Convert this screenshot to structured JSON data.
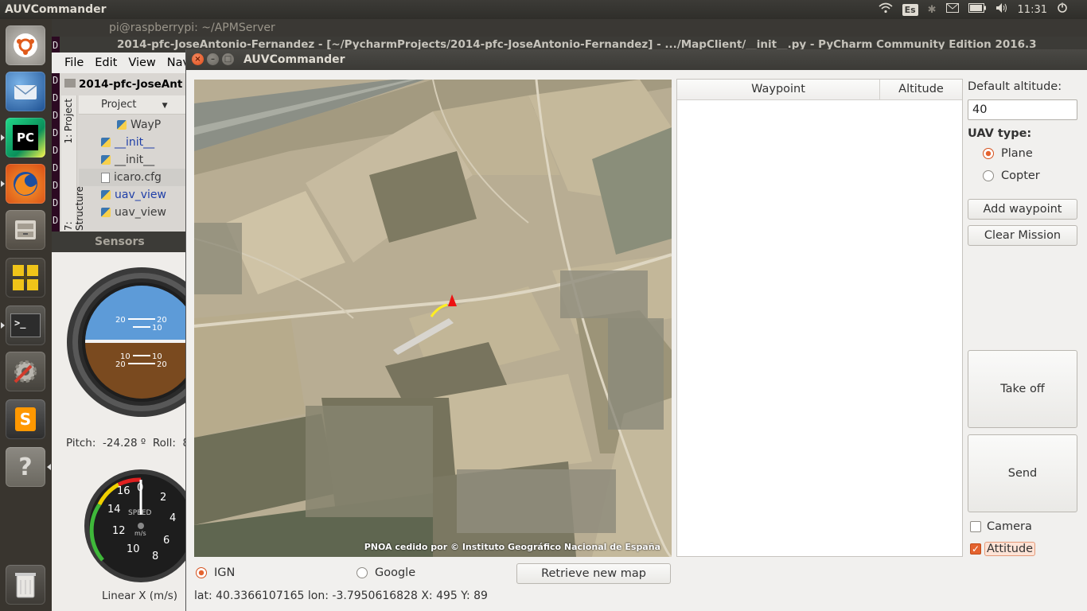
{
  "topbar": {
    "app_title": "AUVCommander",
    "keyboard_layout": "Es",
    "clock": "11:31"
  },
  "launcher": {
    "items": [
      "ubuntu-dash",
      "thunderbird",
      "pycharm",
      "firefox",
      "file-manager",
      "workspace-switcher",
      "terminal",
      "system-settings",
      "sublime-text",
      "help",
      "trash"
    ],
    "pycharm_label": "PC",
    "sublime_label": "S",
    "help_label": "?"
  },
  "terminal_window": {
    "title": "pi@raspberrypi: ~/APMServer"
  },
  "pycharm_window": {
    "title": "2014-pfc-JoseAntonio-Fernandez - [~/PycharmProjects/2014-pfc-JoseAntonio-Fernandez] - .../MapClient/__init__.py - PyCharm Community Edition 2016.3",
    "menu": [
      "File",
      "Edit",
      "View",
      "Navi"
    ],
    "breadcrumb": "2014-pfc-JoseAnt",
    "side_tabs": [
      "1: Project",
      "7: Structure"
    ],
    "project_header": "Project",
    "tree": [
      {
        "name": "WayP",
        "type": "py"
      },
      {
        "name": "__init__",
        "type": "py"
      },
      {
        "name": "__init__",
        "type": "py"
      },
      {
        "name": "icaro.cfg",
        "type": "cfg"
      },
      {
        "name": "uav_view",
        "type": "py"
      },
      {
        "name": "uav_view",
        "type": "py"
      }
    ],
    "terminal_strip": [
      "D",
      "D",
      "D",
      "D",
      "D",
      "D",
      "D",
      "D",
      "D",
      "D",
      "D",
      "D"
    ]
  },
  "sensors_window": {
    "title": "Sensors",
    "horizon_ticks": [
      "20",
      "10",
      "10",
      "20"
    ],
    "pitch_label": "Pitch:",
    "pitch_value": "-24.28",
    "pitch_unit": "º",
    "roll_label": "Roll:",
    "roll_value_partial": "8",
    "speed_gauge": {
      "label": "SPEED",
      "unit": "m/s",
      "ticks": [
        "0",
        "2",
        "4",
        "6",
        "8",
        "10",
        "12",
        "14",
        "16"
      ]
    },
    "speed_caption": "Linear X (m/s)"
  },
  "auv_window": {
    "title": "AUVCommander",
    "map_credit": "PNOA cedido por © Instituto Geográfico Nacional de España",
    "table": {
      "columns": [
        "Waypoint",
        "Altitude"
      ],
      "rows": []
    },
    "default_altitude_label": "Default altitude:",
    "default_altitude_value": "40",
    "uav_type_label": "UAV type:",
    "uav_types": [
      {
        "label": "Plane",
        "selected": true
      },
      {
        "label": "Copter",
        "selected": false
      }
    ],
    "add_waypoint_label": "Add waypoint",
    "clear_mission_label": "Clear Mission",
    "take_off_label": "Take off",
    "send_label": "Send",
    "camera_label": "Camera",
    "camera_checked": false,
    "attitude_label": "Attitude",
    "attitude_checked": true,
    "map_sources": [
      {
        "label": "IGN",
        "selected": true
      },
      {
        "label": "Google",
        "selected": false
      }
    ],
    "retrieve_map_label": "Retrieve new map",
    "status": "lat: 40.3366107165 lon: -3.7950616828 X: 495 Y: 89"
  },
  "colors": {
    "accent": "#e4632f",
    "titlebar": "#3c3b37",
    "launcher": "#39352f"
  }
}
